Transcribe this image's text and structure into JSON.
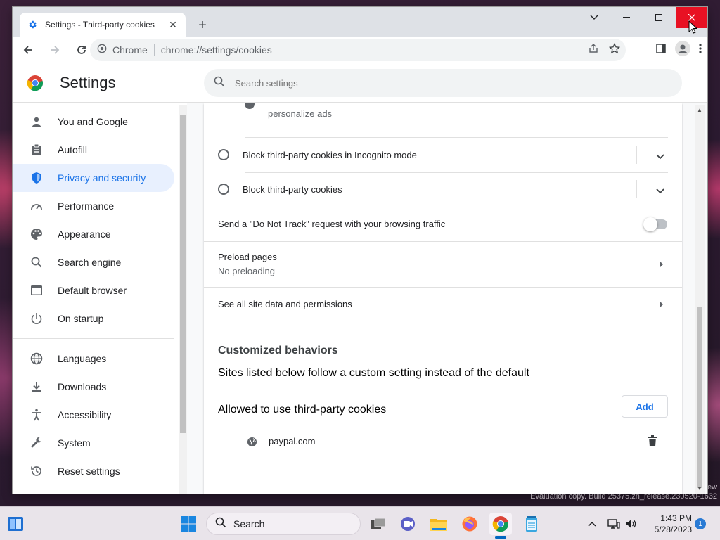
{
  "window": {
    "tab_title": "Settings - Third-party cookies",
    "site_label": "Chrome",
    "url": "chrome://settings/cookies"
  },
  "header": {
    "title": "Settings",
    "search_placeholder": "Search settings"
  },
  "sidebar": {
    "items": [
      {
        "label": "You and Google",
        "icon": "person-icon"
      },
      {
        "label": "Autofill",
        "icon": "clipboard-icon"
      },
      {
        "label": "Privacy and security",
        "icon": "shield-icon",
        "active": true
      },
      {
        "label": "Performance",
        "icon": "gauge-icon"
      },
      {
        "label": "Appearance",
        "icon": "palette-icon"
      },
      {
        "label": "Search engine",
        "icon": "search-icon"
      },
      {
        "label": "Default browser",
        "icon": "browser-icon"
      },
      {
        "label": "On startup",
        "icon": "power-icon"
      },
      {
        "label": "Languages",
        "icon": "globe-icon"
      },
      {
        "label": "Downloads",
        "icon": "download-icon"
      },
      {
        "label": "Accessibility",
        "icon": "accessibility-icon"
      },
      {
        "label": "System",
        "icon": "wrench-icon"
      },
      {
        "label": "Reset settings",
        "icon": "reset-icon"
      }
    ]
  },
  "content": {
    "partial_text": "personalize ads",
    "block_incognito": "Block third-party cookies in Incognito mode",
    "block_third_party": "Block third-party cookies",
    "do_not_track": "Send a \"Do Not Track\" request with your browsing traffic",
    "do_not_track_enabled": false,
    "preload_title": "Preload pages",
    "preload_value": "No preloading",
    "site_data": "See all site data and permissions",
    "customized_heading": "Customized behaviors",
    "customized_desc": "Sites listed below follow a custom setting instead of the default",
    "allowed_label": "Allowed to use third-party cookies",
    "add_button": "Add",
    "allowed_sites": [
      "paypal.com"
    ]
  },
  "taskbar": {
    "search_label": "Search",
    "time": "1:43 PM",
    "date": "5/28/2023",
    "notification_count": "1"
  },
  "desktop": {
    "watermark": "Evaluation copy. Build 25375.zn_release.230520-1632",
    "watermark_edge": "ew"
  },
  "colors": {
    "accent": "#1a73e8",
    "active_nav_bg": "#e8f0fe",
    "close_button": "#e81123"
  }
}
